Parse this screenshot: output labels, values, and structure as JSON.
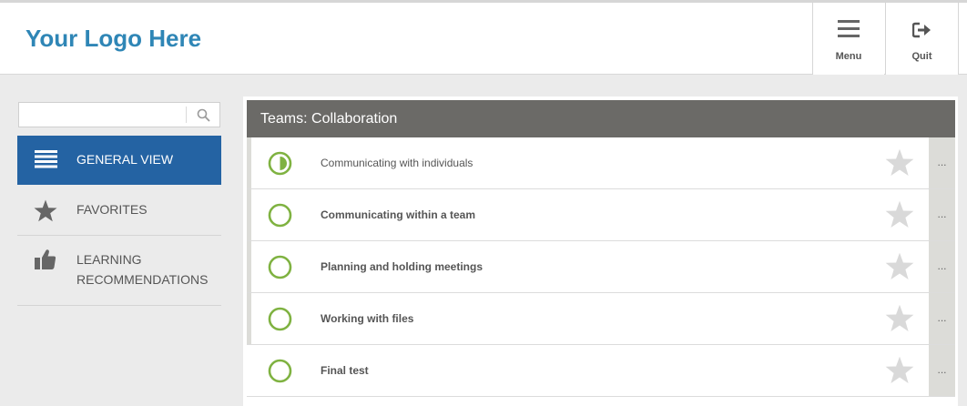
{
  "header": {
    "logo_text": "Your Logo Here",
    "menu_label": "Menu",
    "quit_label": "Quit"
  },
  "search": {
    "value": "",
    "placeholder": ""
  },
  "sidebar": {
    "items": [
      {
        "label": "GENERAL VIEW",
        "icon": "list-icon",
        "active": true
      },
      {
        "label": "FAVORITES",
        "icon": "star-icon",
        "active": false
      },
      {
        "label": "LEARNING RECOMMENDATIONS",
        "icon": "thumbs-up-icon",
        "active": false
      }
    ]
  },
  "panel": {
    "title": "Teams: Collaboration",
    "rows": [
      {
        "title": "Communicating with individuals",
        "status": "half",
        "more": "..."
      },
      {
        "title": "Communicating within a team",
        "status": "empty",
        "more": "..."
      },
      {
        "title": "Planning and holding meetings",
        "status": "empty",
        "more": "..."
      },
      {
        "title": "Working with files",
        "status": "empty",
        "more": "..."
      },
      {
        "title": "Final test",
        "status": "empty",
        "more": "..."
      }
    ]
  },
  "colors": {
    "brand": "#2f86b6",
    "active_nav": "#2463a3",
    "panel_header": "#6b6a67",
    "progress": "#7fb241",
    "star": "#d9d9d9"
  }
}
